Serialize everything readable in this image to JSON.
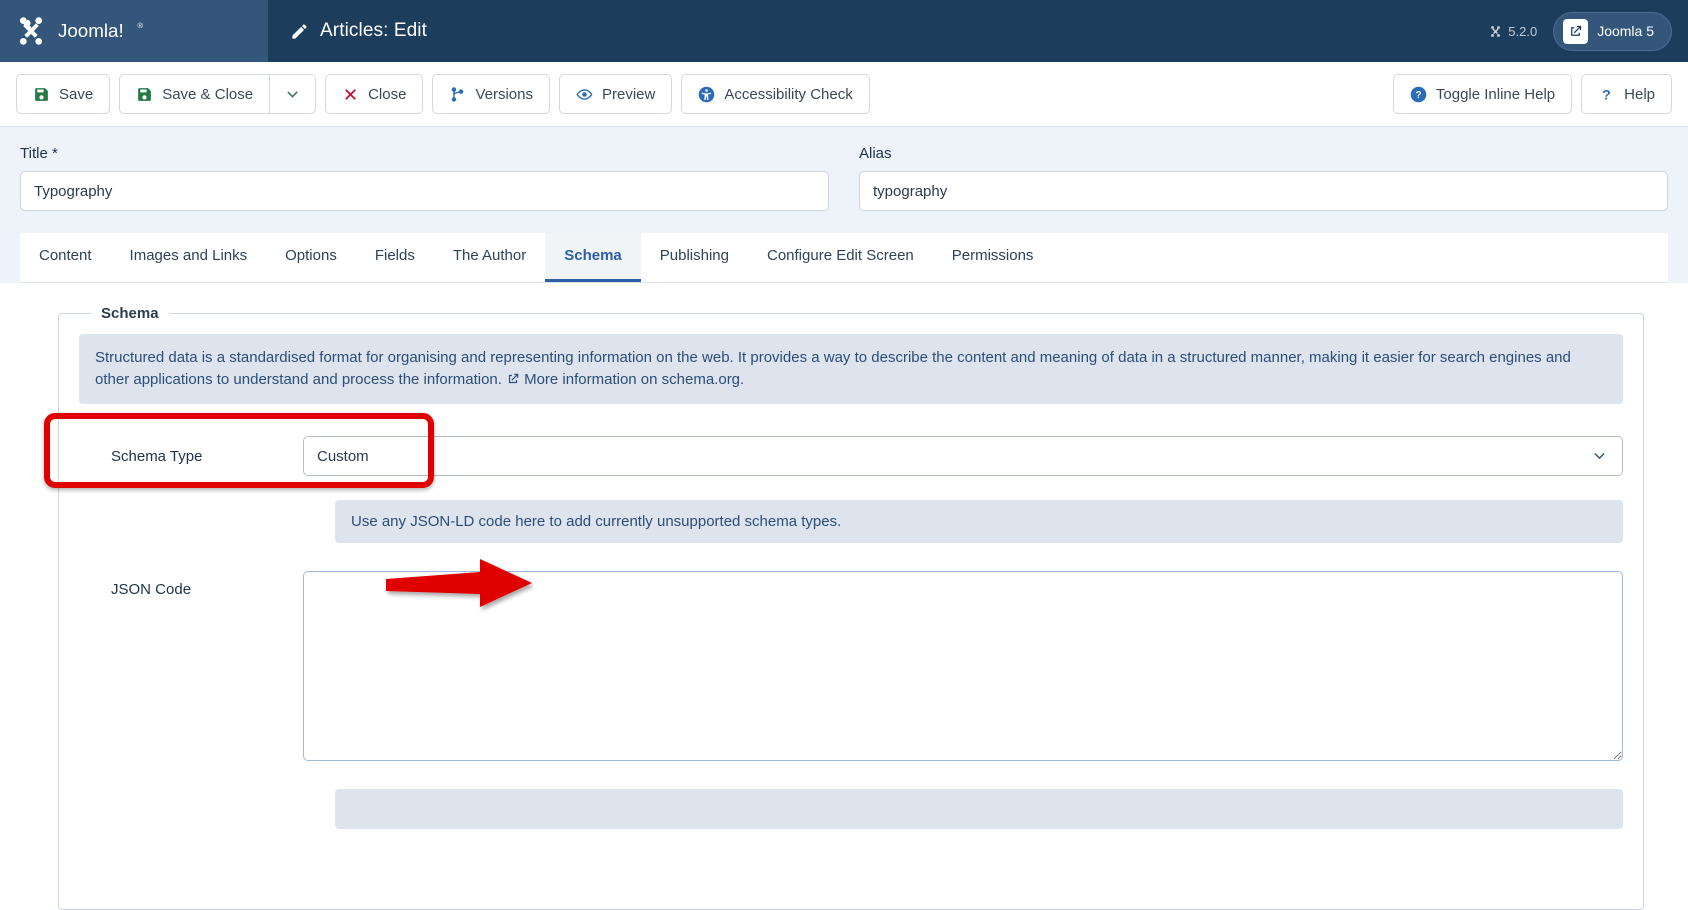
{
  "header": {
    "brand_name": "Joomla!",
    "page_title": "Articles: Edit",
    "page_title_icon": "pencil-icon",
    "version": "5.2.0",
    "version_icon": "joomla-mark-icon",
    "site_button": {
      "label": "Joomla 5",
      "icon": "external-link-icon"
    }
  },
  "toolbar": {
    "buttons": [
      {
        "label": "Save",
        "icon": "save-floppy-icon"
      },
      {
        "label": "Save & Close",
        "icon": "save-floppy-icon"
      },
      {
        "label": "",
        "icon": "chevron-down-icon"
      },
      {
        "label": "Close",
        "icon": "close-x-icon"
      },
      {
        "label": "Versions",
        "icon": "code-branch-icon"
      },
      {
        "label": "Preview",
        "icon": "eye-icon"
      },
      {
        "label": "Accessibility Check",
        "icon": "universal-access-icon"
      }
    ],
    "right_buttons": [
      {
        "label": "Toggle Inline Help",
        "icon": "question-circle-icon"
      },
      {
        "label": "Help",
        "icon": "question-mark-icon"
      }
    ]
  },
  "form": {
    "title": {
      "label": "Title *",
      "value": "Typography",
      "placeholder": ""
    },
    "alias": {
      "label": "Alias",
      "value": "typography",
      "placeholder": ""
    }
  },
  "tabs": [
    {
      "label": "Content",
      "active": false
    },
    {
      "label": "Images and Links",
      "active": false
    },
    {
      "label": "Options",
      "active": false
    },
    {
      "label": "Fields",
      "active": false
    },
    {
      "label": "The Author",
      "active": false
    },
    {
      "label": "Schema",
      "active": true
    },
    {
      "label": "Publishing",
      "active": false
    },
    {
      "label": "Configure Edit Screen",
      "active": false
    },
    {
      "label": "Permissions",
      "active": false
    }
  ],
  "schema_panel": {
    "legend": "Schema",
    "info_text": "Structured data is a standardised format for organising and representing information on the web. It provides a way to describe the content and meaning of data in a structured manner, making it easier for search engines and other applications to understand and process the information.",
    "info_link": "More information on schema.org.",
    "info_link_icon": "external-link-icon",
    "schema_type": {
      "label": "Schema Type",
      "value": "Custom",
      "caret_icon": "chevron-down-icon"
    },
    "custom_hint": "Use any JSON-LD code here to add currently unsupported schema types.",
    "json_code": {
      "label": "JSON Code",
      "value": "",
      "placeholder": ""
    }
  },
  "annotations": [
    {
      "kind": "highlight-rectangle",
      "color": "#e10000",
      "target": "schema-type-field"
    },
    {
      "kind": "pointer-arrow",
      "color": "#e10000",
      "target": "json-code-textarea"
    }
  ],
  "colors": {
    "header_bg": "#1c3d5c",
    "brand_bg": "#33567a",
    "accent_blue": "#2b5ea8",
    "info_bg": "#dde4ee",
    "info_text": "#2d4d77",
    "annotation_red": "#e10000",
    "form_bg": "#eef3fa"
  }
}
